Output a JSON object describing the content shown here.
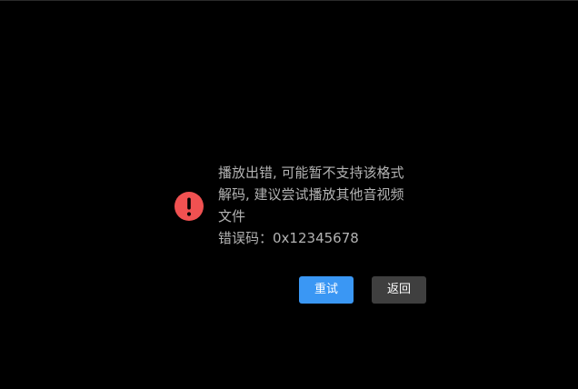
{
  "error": {
    "icon": "exclamation-circle-icon",
    "icon_color": "#f05151",
    "message_lines": [
      "播放出错, 可能暂不支持该格式",
      "解码, 建议尝试播放其他音视频",
      "文件"
    ],
    "code_label": "错误码：",
    "code_value": "0x12345678"
  },
  "actions": {
    "retry_label": "重试",
    "back_label": "返回",
    "retry_color": "#3a97f4",
    "back_color": "#3f3f3f"
  }
}
